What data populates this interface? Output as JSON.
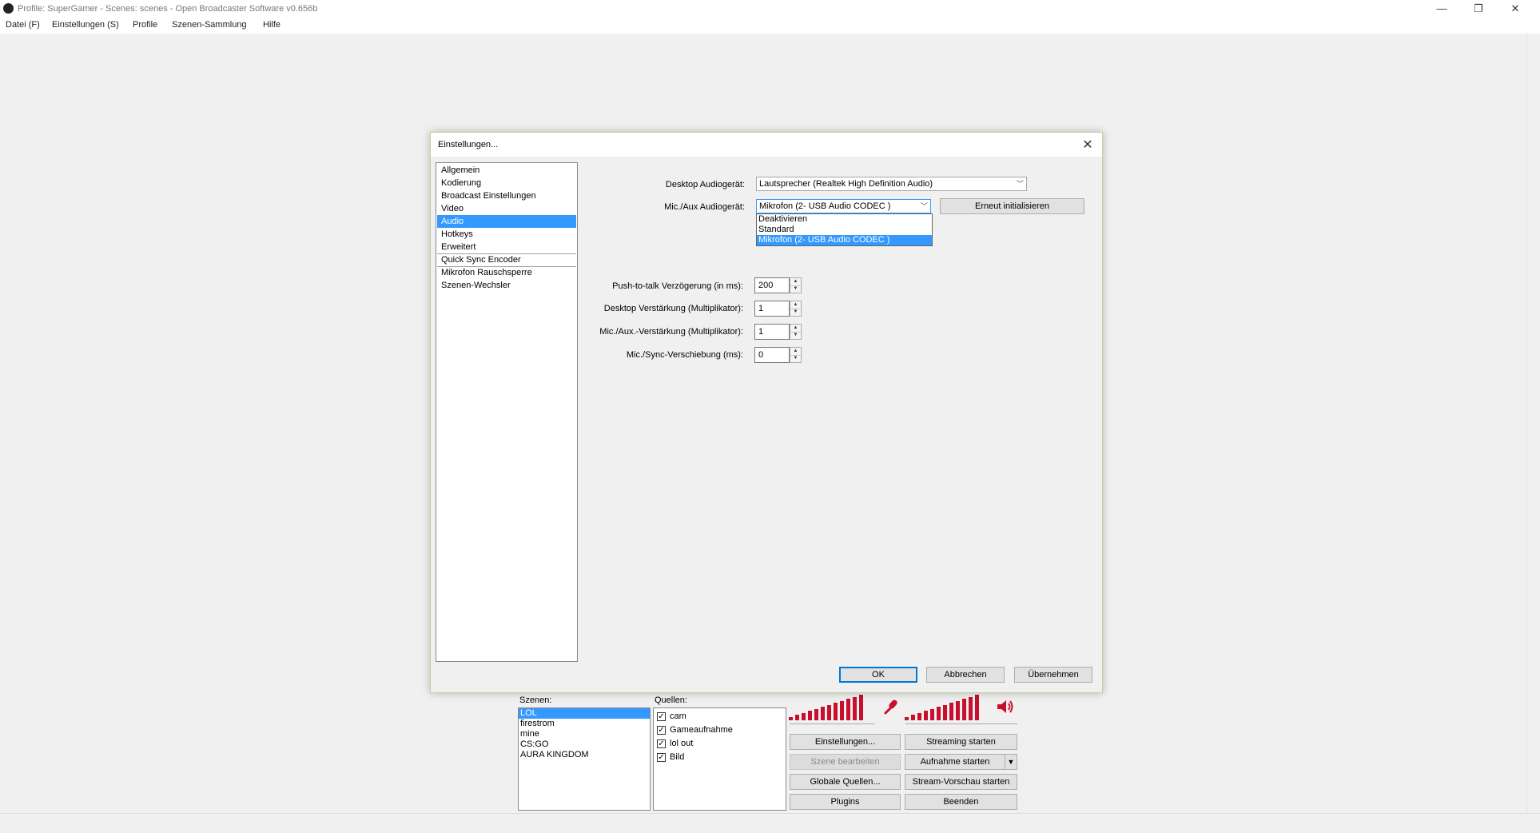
{
  "window": {
    "title": "Profile: SuperGamer - Scenes: scenes - Open Broadcaster Software v0.656b",
    "controls": {
      "minimize": "—",
      "maximize": "❐",
      "close": "✕"
    }
  },
  "menu": [
    "Datei (F)",
    "Einstellungen (S)",
    "Profile",
    "Szenen-Sammlung",
    "Hilfe"
  ],
  "dialog": {
    "title": "Einstellungen...",
    "close": "✕",
    "nav": [
      "Allgemein",
      "Kodierung",
      "Broadcast Einstellungen",
      "Video",
      "Audio",
      "Hotkeys",
      "Erweitert",
      "Quick Sync Encoder",
      "Mikrofon Rauschsperre",
      "Szenen-Wechsler"
    ],
    "nav_selected": "Audio",
    "desktop_device_label": "Desktop Audiogerät:",
    "desktop_device_value": "Lautsprecher (Realtek High Definition Audio)",
    "mic_device_label": "Mic./Aux Audiogerät:",
    "mic_device_value": "Mikrofon (2- USB Audio CODEC )",
    "reinit_button": "Erneut initialisieren",
    "mic_options": [
      "Deaktivieren",
      "Standard",
      "Mikrofon (2- USB Audio CODEC )"
    ],
    "mic_selected_option": "Mikrofon (2- USB Audio CODEC )",
    "ptt_delay_label": "Push-to-talk Verzögerung (in ms):",
    "ptt_delay_value": "200",
    "desktop_boost_label": "Desktop Verstärkung (Multiplikator):",
    "desktop_boost_value": "1",
    "mic_boost_label": "Mic./Aux.-Verstärkung (Multiplikator):",
    "mic_boost_value": "1",
    "mic_offset_label": "Mic./Sync-Verschiebung (ms):",
    "mic_offset_value": "0",
    "ok": "OK",
    "cancel": "Abbrechen",
    "apply": "Übernehmen"
  },
  "main": {
    "scenes_label": "Szenen:",
    "scenes": [
      "LOL",
      "firestrom",
      "mine",
      "CS:GO",
      "AURA KINGDOM"
    ],
    "scene_selected": "LOL",
    "sources_label": "Quellen:",
    "sources": [
      {
        "name": "cam",
        "checked": true
      },
      {
        "name": "Gameaufnahme",
        "checked": true
      },
      {
        "name": "lol out",
        "checked": true
      },
      {
        "name": "Bild",
        "checked": true
      }
    ],
    "buttons": {
      "settings": "Einstellungen...",
      "start_streaming": "Streaming starten",
      "edit_scene": "Szene bearbeiten",
      "start_recording": "Aufnahme starten",
      "global_sources": "Globale Quellen...",
      "preview_stream": "Stream-Vorschau starten",
      "plugins": "Plugins",
      "exit": "Beenden"
    },
    "mic_icon": "microphone-icon",
    "speaker_icon": "speaker-icon",
    "meter_color": "#c8102e"
  }
}
